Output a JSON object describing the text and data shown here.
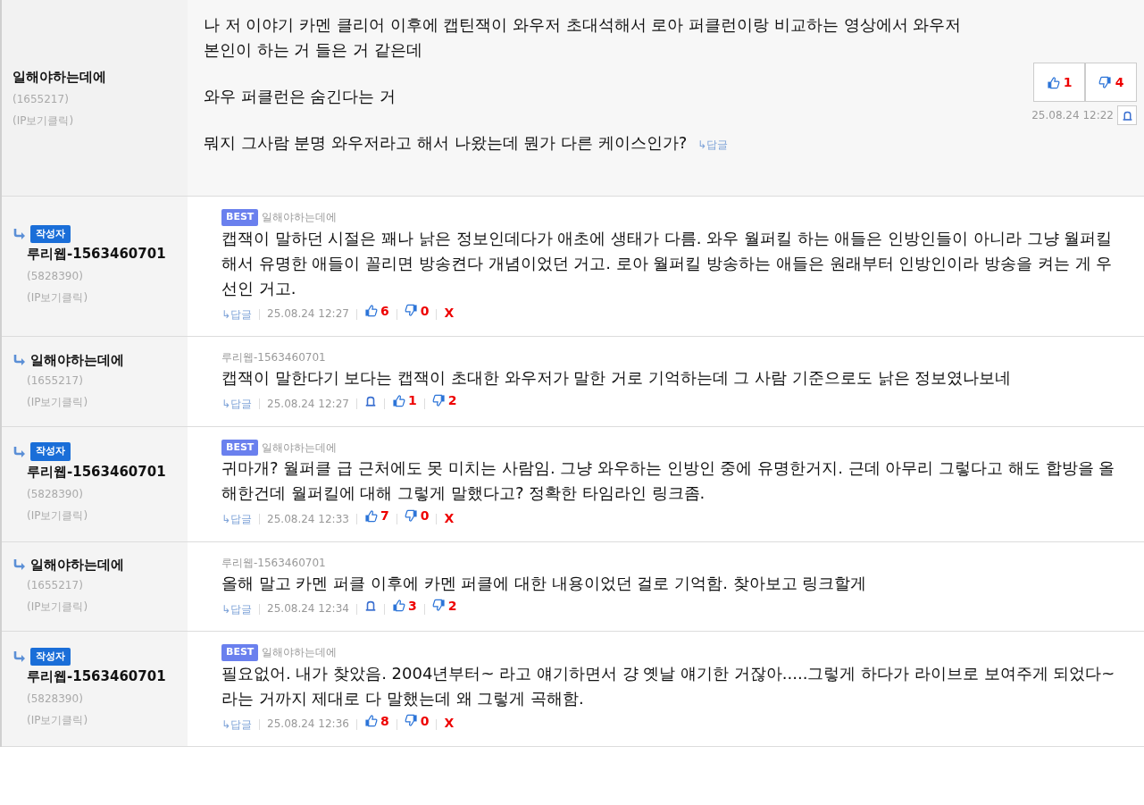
{
  "comments": [
    {
      "kind": "main",
      "author": "일해야하는데에",
      "user_id": "(1655217)",
      "ip": "(IP보기클릭)",
      "paragraphs": [
        "나 저 이야기 카멘 클리어 이후에 캡틴잭이 와우저 초대석해서 로아 퍼클런이랑 비교하는 영상에서 와우저 본인이 하는 거 들은 거 같은데",
        "와우 퍼클런은 숨긴다는 거",
        "뭐지 그사람 분명 와우저라고 해서 나왔는데 뭔가 다른 케이스인가?"
      ],
      "reply": "↳답글",
      "up": "1",
      "down": "4",
      "time": "25.08.24 12:22",
      "report": true
    },
    {
      "kind": "reply",
      "writer_badge": "작성자",
      "author": "루리웹-1563460701",
      "user_id": "(5828390)",
      "ip": "(IP보기클릭)",
      "best": "BEST",
      "parent": "일해야하는데에",
      "text": "캡잭이 말하던 시절은 꽤나 낡은 정보인데다가 애초에 생태가 다름. 와우 월퍼킬 하는 애들은 인방인들이 아니라 그냥 월퍼킬 해서 유명한 애들이 꼴리면 방송켠다 개념이었던 거고. 로아 월퍼킬 방송하는 애들은 원래부터 인방인이라 방송을 켜는 게 우선인 거고.",
      "reply": "↳답글",
      "time": "25.08.24 12:27",
      "report": false,
      "up": "6",
      "down": "0",
      "delete": "X"
    },
    {
      "kind": "reply",
      "author": "일해야하는데에",
      "user_id": "(1655217)",
      "ip": "(IP보기클릭)",
      "parent": "루리웹-1563460701",
      "text": "캡잭이 말한다기 보다는 캡잭이 초대한 와우저가 말한 거로 기억하는데 그 사람 기준으로도 낡은 정보였나보네",
      "reply": "↳답글",
      "time": "25.08.24 12:27",
      "report": true,
      "up": "1",
      "down": "2"
    },
    {
      "kind": "reply",
      "writer_badge": "작성자",
      "author": "루리웹-1563460701",
      "user_id": "(5828390)",
      "ip": "(IP보기클릭)",
      "best": "BEST",
      "parent": "일해야하는데에",
      "text": "귀마개? 월퍼클 급 근처에도 못 미치는 사람임. 그냥 와우하는 인방인 중에 유명한거지. 근데 아무리 그렇다고 해도 합방을 올해한건데 월퍼킬에 대해 그렇게 말했다고? 정확한 타임라인 링크좀.",
      "reply": "↳답글",
      "time": "25.08.24 12:33",
      "report": false,
      "up": "7",
      "down": "0",
      "delete": "X"
    },
    {
      "kind": "reply",
      "author": "일해야하는데에",
      "user_id": "(1655217)",
      "ip": "(IP보기클릭)",
      "parent": "루리웹-1563460701",
      "text": "올해 말고 카멘 퍼클 이후에 카멘 퍼클에 대한 내용이었던 걸로 기억함. 찾아보고 링크할게",
      "reply": "↳답글",
      "time": "25.08.24 12:34",
      "report": true,
      "up": "3",
      "down": "2"
    },
    {
      "kind": "reply",
      "writer_badge": "작성자",
      "author": "루리웹-1563460701",
      "user_id": "(5828390)",
      "ip": "(IP보기클릭)",
      "best": "BEST",
      "parent": "일해야하는데에",
      "text": "필요없어. 내가 찾았음. 2004년부터~ 라고 얘기하면서 걍 옛날 얘기한 거잖아.....그렇게 하다가 라이브로 보여주게 되었다~ 라는 거까지 제대로 다 말했는데 왜 그렇게 곡해함.",
      "reply": "↳답글",
      "time": "25.08.24 12:36",
      "report": false,
      "up": "8",
      "down": "0",
      "delete": "X"
    }
  ]
}
